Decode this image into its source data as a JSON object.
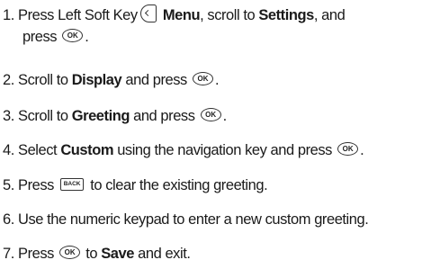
{
  "steps": [
    {
      "num": "1.",
      "press": "Press Left Soft Key",
      "menu": "Menu",
      "scroll_to": ", scroll to",
      "settings": "Settings",
      "and": ", and",
      "press2": "press",
      "end": "."
    },
    {
      "num": "2.",
      "scroll": "Scroll to",
      "target": "Display",
      "and_press": "and press",
      "end": "."
    },
    {
      "num": "3.",
      "scroll": "Scroll to",
      "target": "Greeting",
      "and_press": "and press",
      "end": "."
    },
    {
      "num": "4.",
      "select": "Select",
      "target": "Custom",
      "rest": "using the navigation key and press",
      "end": "."
    },
    {
      "num": "5.",
      "press": "Press",
      "rest": "to clear the existing greeting."
    },
    {
      "num": "6.",
      "text": "Use the numeric keypad to enter a new custom greeting."
    },
    {
      "num": "7.",
      "press": "Press",
      "to": "to",
      "target": "Save",
      "rest": "and exit."
    }
  ],
  "icons": {
    "ok": "ok-key-icon",
    "soft_key": "left-soft-key-icon",
    "back": "back-key-icon"
  }
}
